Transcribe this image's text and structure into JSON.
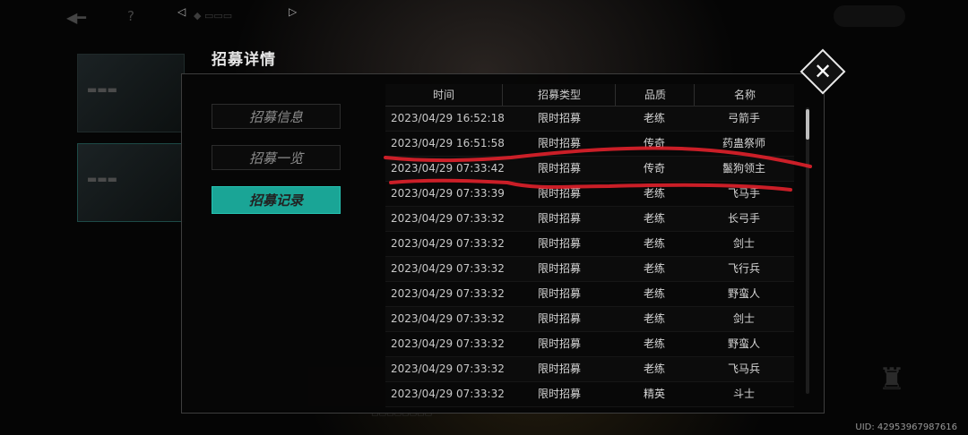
{
  "modal": {
    "title": "招募详情",
    "tabs": [
      "招募信息",
      "招募一览",
      "招募记录"
    ],
    "active_tab": "招募记录"
  },
  "table": {
    "headers": [
      "时间",
      "招募类型",
      "品质",
      "名称"
    ],
    "rows": [
      {
        "time": "2023/04/29 16:52:18",
        "type": "限时招募",
        "quality": "老练",
        "name": "弓箭手"
      },
      {
        "time": "2023/04/29 16:51:58",
        "type": "限时招募",
        "quality": "传奇",
        "name": "药蛊祭师"
      },
      {
        "time": "2023/04/29 07:33:42",
        "type": "限时招募",
        "quality": "传奇",
        "name": "鬣狗领主"
      },
      {
        "time": "2023/04/29 07:33:39",
        "type": "限时招募",
        "quality": "老练",
        "name": "飞马手"
      },
      {
        "time": "2023/04/29 07:33:32",
        "type": "限时招募",
        "quality": "老练",
        "name": "长弓手"
      },
      {
        "time": "2023/04/29 07:33:32",
        "type": "限时招募",
        "quality": "老练",
        "name": "剑士"
      },
      {
        "time": "2023/04/29 07:33:32",
        "type": "限时招募",
        "quality": "老练",
        "name": "飞行兵"
      },
      {
        "time": "2023/04/29 07:33:32",
        "type": "限时招募",
        "quality": "老练",
        "name": "野蛮人"
      },
      {
        "time": "2023/04/29 07:33:32",
        "type": "限时招募",
        "quality": "老练",
        "name": "剑士"
      },
      {
        "time": "2023/04/29 07:33:32",
        "type": "限时招募",
        "quality": "老练",
        "name": "野蛮人"
      },
      {
        "time": "2023/04/29 07:33:32",
        "type": "限时招募",
        "quality": "老练",
        "name": "飞马兵"
      },
      {
        "time": "2023/04/29 07:33:32",
        "type": "限时招募",
        "quality": "精英",
        "name": "斗士"
      }
    ]
  },
  "uid": "UID: 42953967987616",
  "icons": {
    "close": "close-icon",
    "title_ornament": "ornament-icon",
    "back": "back-arrow-icon",
    "help": "help-icon"
  },
  "colors": {
    "active_tab": "#1aa596",
    "annotation": "#e0212b",
    "background": "#000000"
  }
}
